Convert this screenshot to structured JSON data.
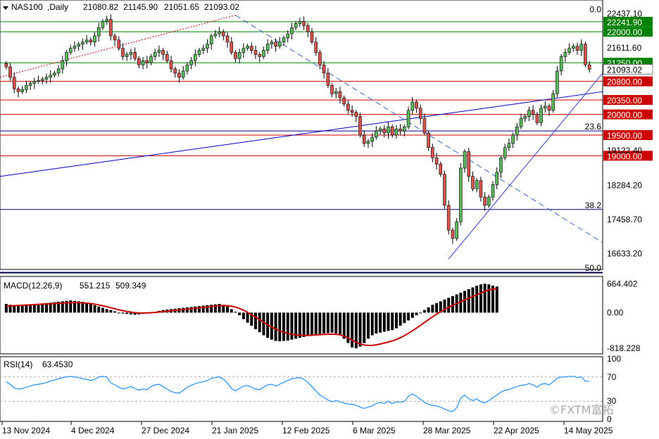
{
  "chart_data": {
    "type": "candlestick",
    "symbol": "NAS100",
    "timeframe": "Daily",
    "header_ohlc": [
      "21080.82",
      "21145.90",
      "21051.65",
      "21093.02"
    ],
    "price_axis": {
      "min": 16300,
      "max": 22700,
      "tick_labels": [
        "22437.10",
        "21611.60",
        "19122.40",
        "18284.20",
        "17458.70",
        "16633.20"
      ],
      "current_price_label": "21093.02"
    },
    "levels": [
      {
        "value": 22241.9,
        "label": "22241.90",
        "color": "#008000"
      },
      {
        "value": 22000.0,
        "label": "22000.00",
        "color": "#008000"
      },
      {
        "value": 21250.0,
        "label": "21250.00",
        "color": "#008000"
      },
      {
        "value": 20800.0,
        "label": "20800.00",
        "color": "#cc0000"
      },
      {
        "value": 20350.0,
        "label": "20350.00",
        "color": "#cc0000"
      },
      {
        "value": 20000.0,
        "label": "20000.00",
        "color": "#cc0000"
      },
      {
        "value": 19500.0,
        "label": "19500.00",
        "color": "#cc0000"
      },
      {
        "value": 19000.0,
        "label": "19000.00",
        "color": "#cc0000"
      }
    ],
    "fibonacci": [
      {
        "label": "0.0",
        "value": 22437.1
      },
      {
        "label": "23.6",
        "value": 19600
      },
      {
        "label": "38.2",
        "value": 17700
      },
      {
        "label": "50.0",
        "value": 16180
      }
    ],
    "date_labels": [
      "13 Nov 2024",
      "4 Dec 2024",
      "27 Dec 2024",
      "21 Jan 2025",
      "12 Feb 2025",
      "6 Mar 2025",
      "28 Mar 2025",
      "22 Apr 2025",
      "14 May 2025"
    ],
    "candles_close": [
      21150,
      20900,
      20620,
      20550,
      20600,
      20700,
      20750,
      20800,
      20820,
      20850,
      20900,
      20950,
      21000,
      21100,
      21300,
      21500,
      21600,
      21650,
      21700,
      21750,
      21800,
      21750,
      21900,
      22100,
      22250,
      22300,
      21900,
      21800,
      21600,
      21400,
      21450,
      21500,
      21350,
      21200,
      21300,
      21250,
      21400,
      21500,
      21550,
      21450,
      21300,
      21100,
      21000,
      20900,
      21050,
      21200,
      21300,
      21450,
      21550,
      21600,
      21700,
      21900,
      21950,
      22000,
      21900,
      21750,
      21500,
      21350,
      21500,
      21600,
      21650,
      21550,
      21450,
      21400,
      21550,
      21700,
      21750,
      21650,
      21750,
      21850,
      21950,
      22100,
      22200,
      22250,
      22150,
      22000,
      21750,
      21500,
      21200,
      21000,
      20700,
      20500,
      20550,
      20400,
      20250,
      20100,
      20050,
      19950,
      19500,
      19300,
      19350,
      19450,
      19600,
      19650,
      19550,
      19700,
      19500,
      19650,
      19600,
      19700,
      20100,
      20300,
      20150,
      19900,
      19550,
      19200,
      18950,
      18800,
      18550,
      17800,
      17200,
      17000,
      17400,
      18700,
      19100,
      18500,
      18200,
      18400,
      18000,
      17800,
      18000,
      18300,
      18600,
      18950,
      19200,
      19300,
      19500,
      19700,
      19900,
      19950,
      20100,
      20000,
      19800,
      20150,
      20200,
      20100,
      20500,
      21050,
      21400,
      21500,
      21600,
      21650,
      21550,
      21700,
      21200,
      21093
    ],
    "macd": {
      "label": "MACD(12,26,9)",
      "macd_value": "551.215",
      "signal_value": "509.349",
      "axis_labels": [
        "664.402",
        "0.00",
        "-818.228"
      ],
      "min": -900,
      "max": 750,
      "histogram": [
        200,
        180,
        170,
        160,
        160,
        170,
        180,
        190,
        200,
        210,
        220,
        230,
        240,
        250,
        260,
        270,
        280,
        270,
        260,
        250,
        230,
        200,
        170,
        140,
        110,
        80,
        60,
        30,
        0,
        -20,
        -30,
        -40,
        -50,
        -40,
        -30,
        -20,
        0,
        20,
        40,
        60,
        70,
        80,
        90,
        100,
        110,
        120,
        130,
        140,
        150,
        160,
        170,
        180,
        190,
        200,
        180,
        140,
        80,
        20,
        -60,
        -150,
        -230,
        -300,
        -380,
        -450,
        -520,
        -580,
        -620,
        -650,
        -660,
        -650,
        -640,
        -620,
        -600,
        -580,
        -560,
        -540,
        -520,
        -500,
        -490,
        -480,
        -470,
        -460,
        -480,
        -520,
        -600,
        -700,
        -800,
        -820,
        -780,
        -700,
        -600,
        -520,
        -480,
        -460,
        -440,
        -420,
        -400,
        -360,
        -300,
        -240,
        -180,
        -120,
        -60,
        0,
        60,
        120,
        180,
        220,
        260,
        300,
        340,
        380,
        420,
        460,
        500,
        540,
        580,
        620,
        650,
        664,
        650,
        620,
        600
      ],
      "signal": [
        150,
        155,
        160,
        165,
        170,
        175,
        180,
        185,
        190,
        195,
        200,
        205,
        210,
        215,
        220,
        225,
        230,
        232,
        230,
        225,
        218,
        208,
        195,
        178,
        158,
        136,
        112,
        88,
        64,
        44,
        26,
        12,
        0,
        -6,
        -8,
        -6,
        -2,
        4,
        12,
        22,
        32,
        42,
        52,
        62,
        72,
        82,
        92,
        102,
        112,
        122,
        132,
        142,
        152,
        160,
        164,
        160,
        148,
        128,
        96,
        56,
        8,
        -46,
        -102,
        -160,
        -220,
        -278,
        -332,
        -380,
        -420,
        -452,
        -478,
        -498,
        -512,
        -520,
        -524,
        -524,
        -520,
        -514,
        -508,
        -502,
        -498,
        -496,
        -500,
        -512,
        -540,
        -580,
        -630,
        -680,
        -720,
        -745,
        -755,
        -752,
        -740,
        -722,
        -700,
        -676,
        -650,
        -618,
        -578,
        -530,
        -476,
        -418,
        -356,
        -292,
        -226,
        -160,
        -96,
        -36,
        20,
        72,
        120,
        166,
        208,
        250,
        290,
        330,
        370,
        410,
        450,
        490,
        520,
        540,
        550
      ]
    },
    "rsi": {
      "label": "RSI(14)",
      "value": "63.4530",
      "axis_labels": [
        "100",
        "70",
        "30",
        "0"
      ],
      "levels": [
        70,
        30
      ],
      "values": [
        62,
        58,
        52,
        50,
        51,
        53,
        55,
        57,
        58,
        59,
        61,
        63,
        65,
        67,
        69,
        70,
        71,
        70,
        69,
        67,
        66,
        64,
        66,
        70,
        71,
        70,
        60,
        57,
        53,
        50,
        52,
        54,
        51,
        48,
        50,
        49,
        54,
        57,
        58,
        54,
        50,
        46,
        44,
        43,
        48,
        53,
        56,
        59,
        61,
        62,
        64,
        68,
        69,
        70,
        66,
        60,
        51,
        47,
        51,
        55,
        56,
        53,
        50,
        49,
        53,
        57,
        58,
        55,
        58,
        61,
        64,
        67,
        68,
        69,
        66,
        61,
        54,
        47,
        40,
        36,
        32,
        29,
        31,
        29,
        27,
        25,
        25,
        23,
        20,
        18,
        20,
        22,
        26,
        28,
        26,
        30,
        26,
        29,
        28,
        30,
        38,
        42,
        38,
        33,
        28,
        25,
        23,
        22,
        20,
        17,
        14,
        13,
        19,
        35,
        40,
        34,
        31,
        34,
        29,
        27,
        31,
        36,
        40,
        45,
        48,
        49,
        52,
        54,
        56,
        57,
        59,
        57,
        53,
        58,
        59,
        57,
        62,
        68,
        70,
        70,
        71,
        71,
        69,
        70,
        63,
        63
      ]
    }
  },
  "watermark": "©FXTM富拓"
}
